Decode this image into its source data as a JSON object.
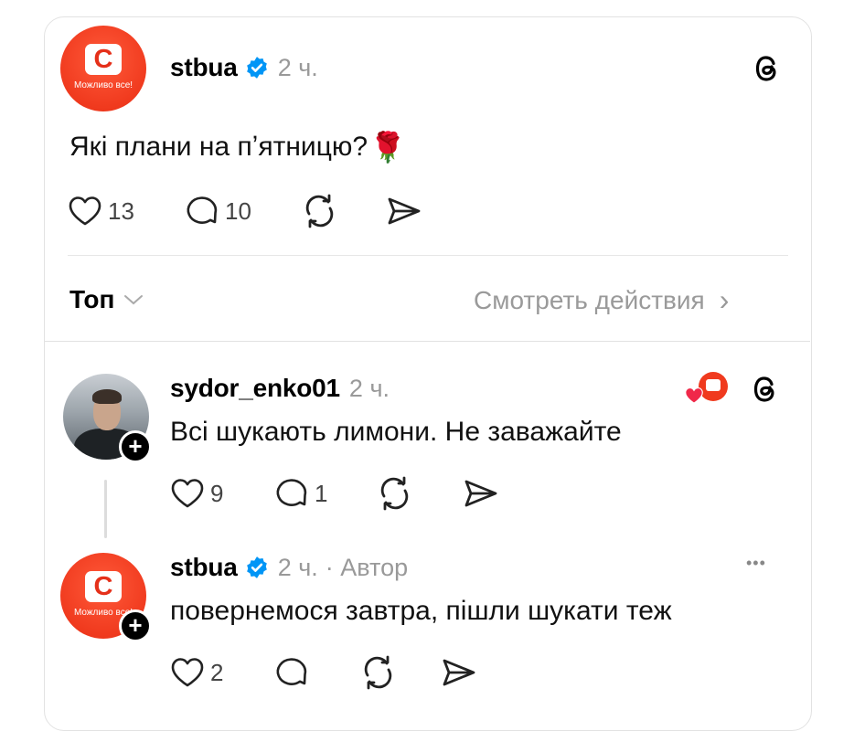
{
  "post": {
    "username": "stbua",
    "time": "2 ч.",
    "avatar_slogan": "Можливо все!",
    "avatar_letter": "С",
    "text": "Які плани на пʼятницю?",
    "emoji": "🌹",
    "likes": "13",
    "replies": "10"
  },
  "sort_bar": {
    "sort_label": "Топ",
    "activity_label": "Смотреть действия",
    "activity_chevron": "›"
  },
  "replies": [
    {
      "username": "sydor_enko01",
      "time": "2 ч.",
      "text": "Всі шукають лимони. Не заважайте",
      "likes": "9",
      "replies": "1",
      "liked_by_author_icon": "heart-with-avatar-icon"
    },
    {
      "username": "stbua",
      "time": "2 ч.",
      "author_badge": "· Автор",
      "avatar_slogan": "Можливо все!",
      "avatar_letter": "С",
      "text": "повернемося завтра, пішли шукати теж",
      "likes": "2",
      "more": "•••"
    }
  ],
  "colors": {
    "brand": "#f03a1e",
    "verified": "#0095f6",
    "muted": "#999999"
  }
}
